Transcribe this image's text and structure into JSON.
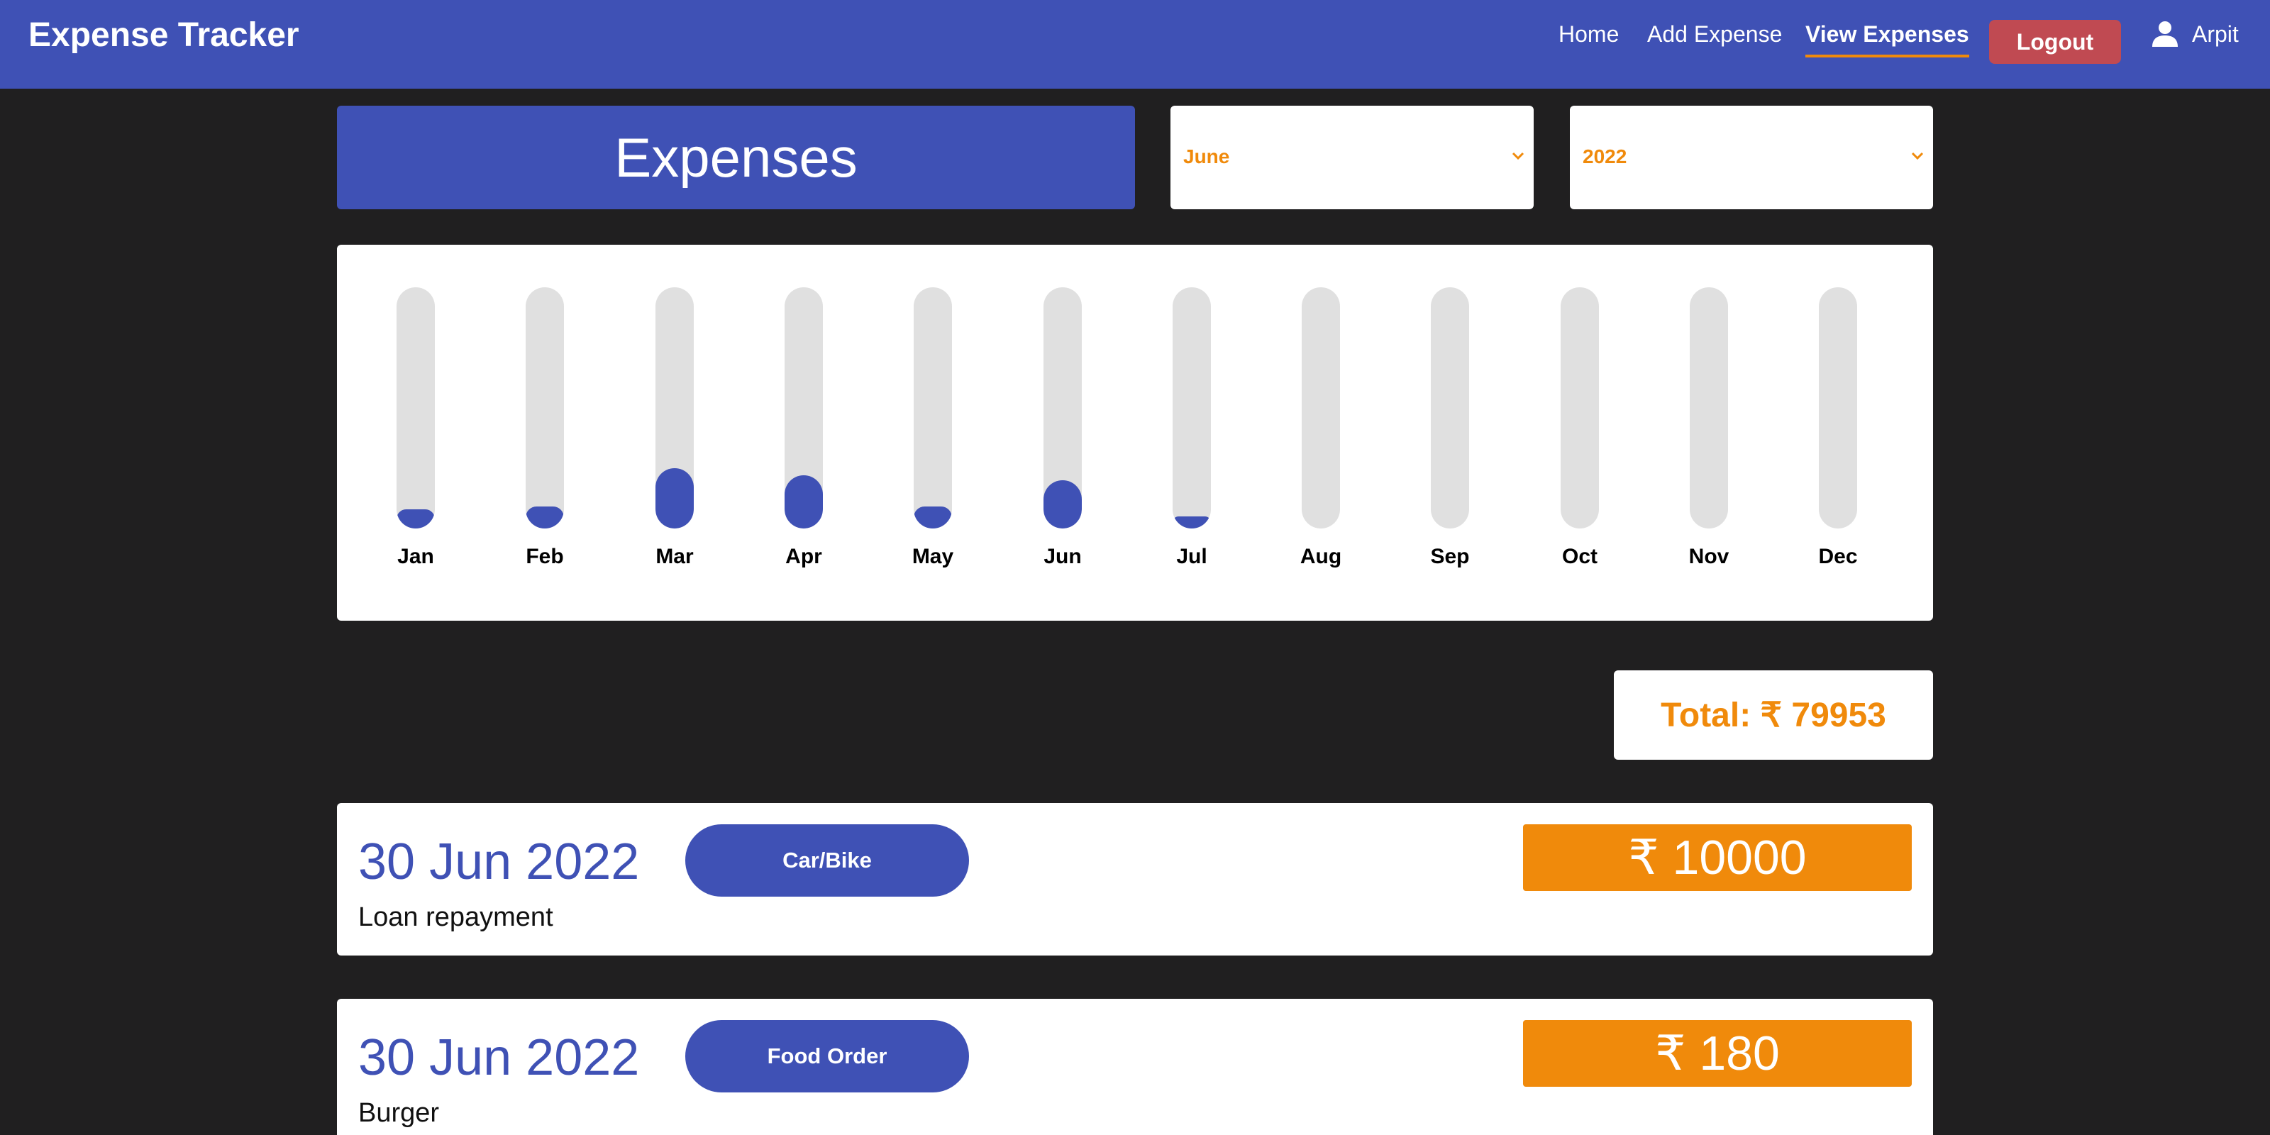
{
  "navbar": {
    "brand": "Expense Tracker",
    "links": {
      "home": "Home",
      "add": "Add Expense",
      "view": "View Expenses"
    },
    "logout": "Logout",
    "user": "Arpit",
    "user_icon": "person-icon",
    "color": "#3f51b5"
  },
  "header": {
    "title": "Expenses",
    "month": "June",
    "year": "2022"
  },
  "chart_data": {
    "type": "bar",
    "categories": [
      "Jan",
      "Feb",
      "Mar",
      "Apr",
      "May",
      "Jun",
      "Jul",
      "Aug",
      "Sep",
      "Oct",
      "Nov",
      "Dec"
    ],
    "values": [
      0.08,
      0.09,
      0.25,
      0.22,
      0.09,
      0.2,
      0.05,
      0,
      0,
      0,
      0,
      0
    ],
    "value_unit": "fraction of maximum bar",
    "bar_color": "#3f51b5",
    "track_color": "#e0e0e0"
  },
  "total": {
    "label": "Total: ₹ 79953"
  },
  "expenses": [
    {
      "date": "30 Jun 2022",
      "description": "Loan repayment",
      "category": "Car/Bike",
      "amount": "₹ 10000"
    },
    {
      "date": "30 Jun 2022",
      "description": "Burger",
      "category": "Food Order",
      "amount": "₹ 180"
    }
  ],
  "colors": {
    "accent": "#3f51b5",
    "highlight": "#f08a0b",
    "logout": "#c04a52",
    "background": "#201f20"
  }
}
